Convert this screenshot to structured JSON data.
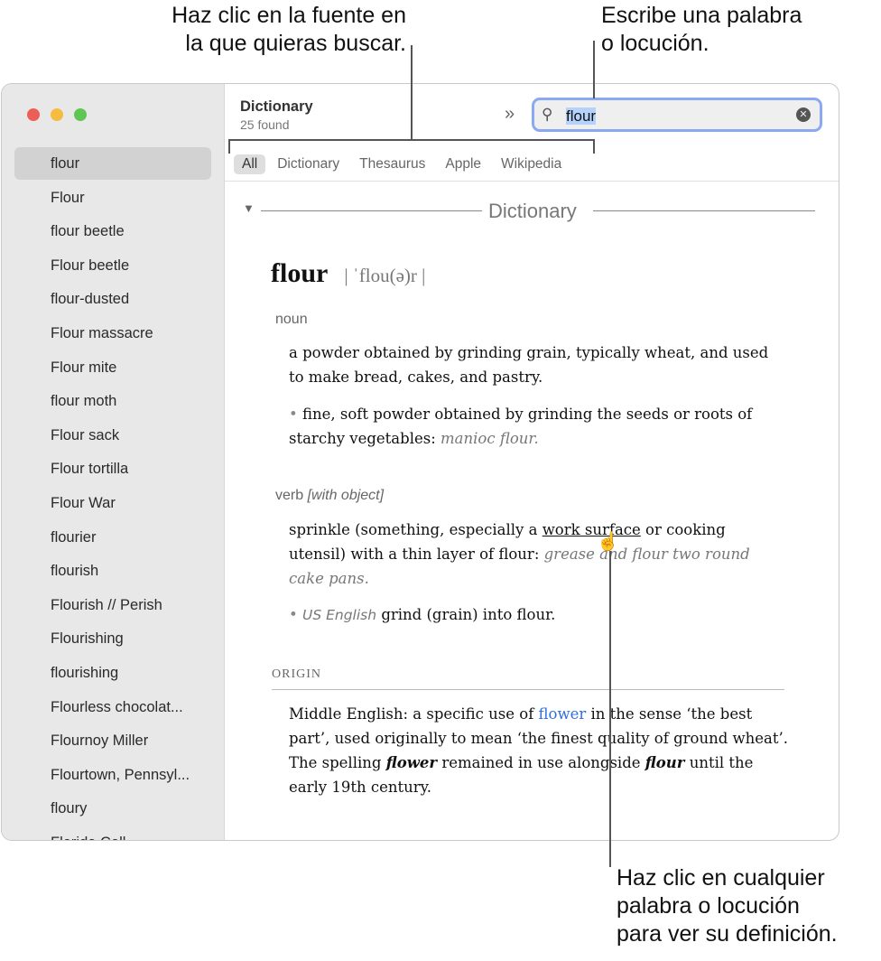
{
  "callouts": {
    "source": [
      "Haz clic en la fuente en",
      "la que quieras buscar."
    ],
    "search": [
      "Escribe una palabra",
      "o locución."
    ],
    "word": [
      "Haz clic en cualquier",
      "palabra o locución",
      "para ver su definición."
    ]
  },
  "sidebar": {
    "items": [
      "flour",
      "Flour",
      "flour beetle",
      "Flour beetle",
      "flour-dusted",
      "Flour massacre",
      "Flour mite",
      "flour moth",
      "Flour sack",
      "Flour tortilla",
      "Flour War",
      "flourier",
      "flourish",
      "Flourish // Perish",
      "Flourishing",
      "flourishing",
      "Flourless chocolat...",
      "Flournoy Miller",
      "Flourtown, Pennsyl...",
      "floury",
      "Florida Coll..."
    ]
  },
  "header": {
    "title": "Dictionary",
    "count": "25 found",
    "search_value": "flour"
  },
  "tabs": [
    "All",
    "Dictionary",
    "Thesaurus",
    "Apple",
    "Wikipedia"
  ],
  "entry": {
    "section": "Dictionary",
    "word": "flour",
    "pron": "| ˈflou(ə)r |",
    "noun_label": "noun",
    "noun_def1": "a powder obtained by grinding grain, typically wheat, and used to make bread, cakes, and pastry.",
    "noun_def2": "fine, soft powder obtained by grinding the seeds or roots of starchy vegetables:",
    "noun_ex2": "manioc flour.",
    "verb_label": "verb",
    "verb_qual": "[with object]",
    "verb_def1a": "sprinkle (something, especially a ",
    "verb_link": "work surface",
    "verb_def1b": " or cooking utensil) with a thin layer of flour:",
    "verb_ex1": "grease and flour two round cake pans.",
    "verb_reg": "US English",
    "verb_def2": "grind (grain) into flour.",
    "origin_label": "ORIGIN",
    "origin_a": "Middle English: a specific use of ",
    "origin_link": "flower",
    "origin_b": " in the sense ‘the best part’, used originally to mean ‘the finest quality of ground wheat’. The spelling ",
    "origin_c": "flower",
    "origin_d": " remained in use alongside ",
    "origin_e": "flour",
    "origin_f": " until the early 19th century."
  },
  "colors": {
    "link": "#2f6fdc",
    "focus": "#8aa9f0"
  }
}
